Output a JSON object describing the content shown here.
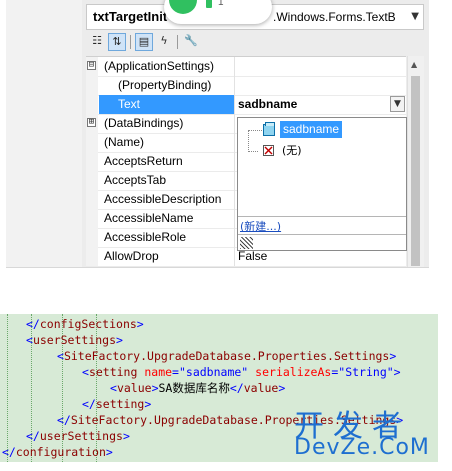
{
  "properties_window": {
    "object_name": "txtTargetInit",
    "object_type": ".Windows.Forms.TextB",
    "popup_digit": "1",
    "toolbar": {
      "buttons": [
        "categorized-icon",
        "alphabetical-icon",
        "properties-icon",
        "events-icon",
        "property-pages-icon"
      ]
    },
    "rows": [
      {
        "name": "(ApplicationSettings)",
        "value": "",
        "expander": "⊟",
        "indent": false
      },
      {
        "name": "(PropertyBinding)",
        "value": "",
        "expander": "",
        "indent": true
      },
      {
        "name": "Text",
        "value": "sadbname",
        "expander": "",
        "indent": true,
        "selected": true
      },
      {
        "name": "(DataBindings)",
        "value": "",
        "expander": "⊞",
        "indent": false
      },
      {
        "name": "(Name)",
        "value": "",
        "expander": "",
        "indent": false
      },
      {
        "name": "AcceptsReturn",
        "value": "",
        "expander": "",
        "indent": false
      },
      {
        "name": "AcceptsTab",
        "value": "",
        "expander": "",
        "indent": false
      },
      {
        "name": "AccessibleDescription",
        "value": "",
        "expander": "",
        "indent": false
      },
      {
        "name": "AccessibleName",
        "value": "",
        "expander": "",
        "indent": false
      },
      {
        "name": "AccessibleRole",
        "value": "",
        "expander": "",
        "indent": false
      },
      {
        "name": "AllowDrop",
        "value": "False",
        "expander": "",
        "indent": false
      }
    ],
    "dropdown": {
      "items": [
        "sadbname",
        "(无)"
      ],
      "new_link": "(新建...)"
    }
  },
  "xml": {
    "lines": [
      {
        "indent": 1,
        "parts": [
          [
            "p",
            "</"
          ],
          [
            "t",
            "configSections"
          ],
          [
            "p",
            ">"
          ]
        ]
      },
      {
        "indent": 1,
        "parts": [
          [
            "p",
            "<"
          ],
          [
            "t",
            "userSettings"
          ],
          [
            "p",
            ">"
          ]
        ]
      },
      {
        "indent": 2,
        "parts": [
          [
            "p",
            "<"
          ],
          [
            "t",
            "SiteFactory.UpgradeDatabase.Properties.Settings"
          ],
          [
            "p",
            ">"
          ]
        ]
      },
      {
        "indent": 3,
        "parts": [
          [
            "p",
            "<"
          ],
          [
            "t",
            "setting"
          ],
          [
            "tx",
            " "
          ],
          [
            "a",
            "name"
          ],
          [
            "p",
            "="
          ],
          [
            "v",
            "\"sadbname\""
          ],
          [
            "tx",
            " "
          ],
          [
            "a",
            "serializeAs"
          ],
          [
            "p",
            "="
          ],
          [
            "v",
            "\"String\""
          ],
          [
            "p",
            ">"
          ]
        ]
      },
      {
        "indent": 4,
        "parts": [
          [
            "p",
            "<"
          ],
          [
            "t",
            "value"
          ],
          [
            "p",
            ">"
          ],
          [
            "tx",
            "SA数据库名称"
          ],
          [
            "p",
            "</"
          ],
          [
            "t",
            "value"
          ],
          [
            "p",
            ">"
          ]
        ]
      },
      {
        "indent": 3,
        "parts": [
          [
            "p",
            "</"
          ],
          [
            "t",
            "setting"
          ],
          [
            "p",
            ">"
          ]
        ]
      },
      {
        "indent": 2,
        "parts": [
          [
            "p",
            "</"
          ],
          [
            "t",
            "SiteFactory.UpgradeDatabase.Properties.Settings"
          ],
          [
            "p",
            ">"
          ]
        ]
      },
      {
        "indent": 1,
        "parts": [
          [
            "p",
            "</"
          ],
          [
            "t",
            "userSettings"
          ],
          [
            "p",
            ">"
          ]
        ]
      },
      {
        "indent": 0,
        "parts": [
          [
            "p",
            "</"
          ],
          [
            "t",
            "configuration"
          ],
          [
            "p",
            ">"
          ]
        ]
      }
    ]
  },
  "watermark": {
    "line1": "开发者",
    "line2": "DevZe.CoM"
  },
  "colors": {
    "selection": "#3399ff",
    "xml_background": "#d7ead6",
    "xml_tag": "#8b0000",
    "xml_attr": "#ff0000",
    "xml_punct": "#0000ff",
    "watermark": "#1e6fd0"
  }
}
